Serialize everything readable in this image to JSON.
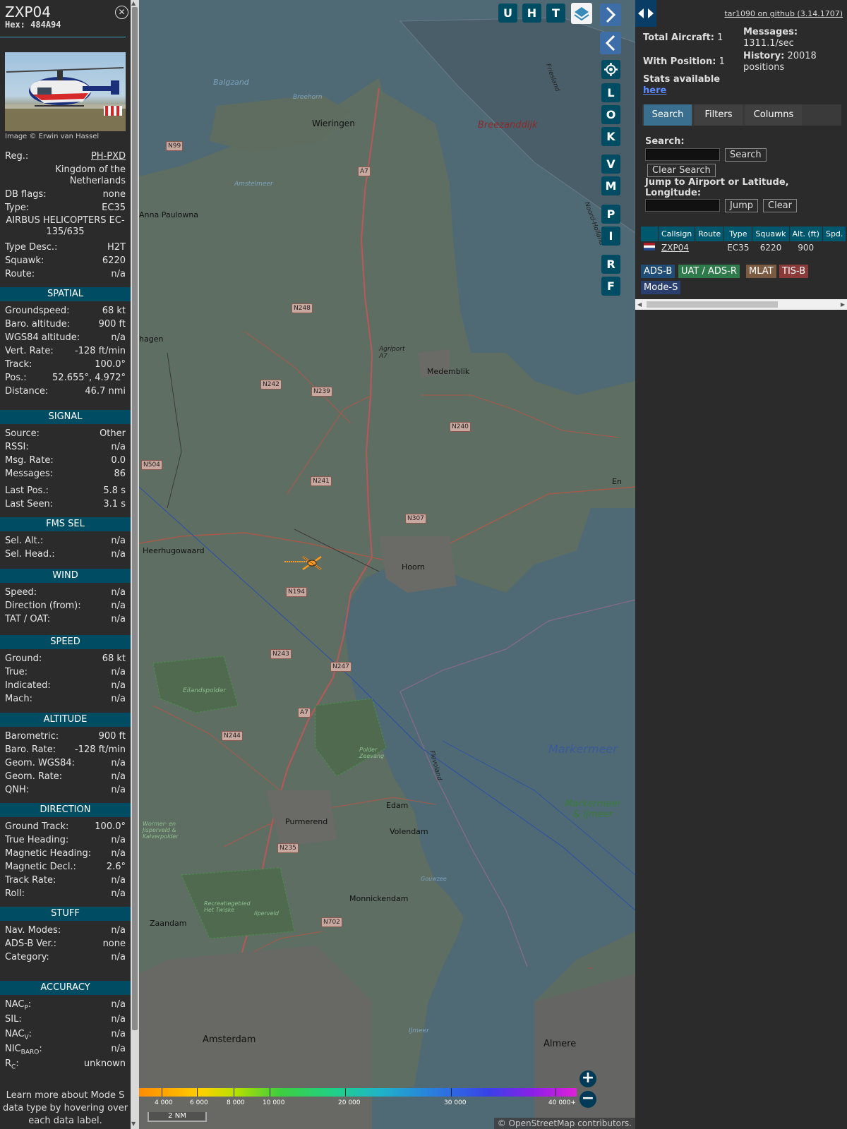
{
  "aircraft": {
    "callsign": "ZXP04",
    "hex_label": "Hex:",
    "hex": "484A94",
    "image_credit": "Image © Erwin van Hassel",
    "reg_label": "Reg.:",
    "reg": "PH-PXD",
    "country": "Kingdom of the Netherlands",
    "db_flags_label": "DB flags:",
    "db_flags": "none",
    "type_label": "Type:",
    "type": "EC35",
    "model": "AIRBUS HELICOPTERS EC-135/635",
    "type_desc_label": "Type Desc.:",
    "type_desc": "H2T",
    "squawk_label": "Squawk:",
    "squawk": "6220",
    "route_label": "Route:",
    "route": "n/a"
  },
  "sections": {
    "spatial": {
      "title": "SPATIAL",
      "rows": [
        {
          "k": "Groundspeed:",
          "v": "68 kt"
        },
        {
          "k": "Baro. altitude:",
          "v": "900 ft"
        },
        {
          "k": "WGS84 altitude:",
          "v": "n/a"
        },
        {
          "k": "Vert. Rate:",
          "v": "-128 ft/min"
        },
        {
          "k": "Track:",
          "v": "100.0°"
        },
        {
          "k": "Pos.:",
          "v": "52.655°, 4.972°"
        },
        {
          "k": "Distance:",
          "v": "46.7 nmi"
        }
      ]
    },
    "signal": {
      "title": "SIGNAL",
      "rows": [
        {
          "k": "Source:",
          "v": "Other"
        },
        {
          "k": "RSSI:",
          "v": "n/a"
        },
        {
          "k": "Msg. Rate:",
          "v": "0.0"
        },
        {
          "k": "Messages:",
          "v": "86"
        },
        {
          "k": "Last Pos.:",
          "v": "5.8 s"
        },
        {
          "k": "Last Seen:",
          "v": "3.1 s"
        }
      ]
    },
    "fms": {
      "title": "FMS SEL",
      "rows": [
        {
          "k": "Sel. Alt.:",
          "v": "n/a"
        },
        {
          "k": "Sel. Head.:",
          "v": "n/a"
        }
      ]
    },
    "wind": {
      "title": "WIND",
      "rows": [
        {
          "k": "Speed:",
          "v": "n/a"
        },
        {
          "k": "Direction (from):",
          "v": "n/a"
        },
        {
          "k": "TAT / OAT:",
          "v": "n/a"
        }
      ]
    },
    "speed": {
      "title": "SPEED",
      "rows": [
        {
          "k": "Ground:",
          "v": "68 kt"
        },
        {
          "k": "True:",
          "v": "n/a"
        },
        {
          "k": "Indicated:",
          "v": "n/a"
        },
        {
          "k": "Mach:",
          "v": "n/a"
        }
      ]
    },
    "altitude": {
      "title": "ALTITUDE",
      "rows": [
        {
          "k": "Barometric:",
          "v": "900 ft"
        },
        {
          "k": "Baro. Rate:",
          "v": "-128 ft/min"
        },
        {
          "k": "Geom. WGS84:",
          "v": "n/a"
        },
        {
          "k": "Geom. Rate:",
          "v": "n/a"
        },
        {
          "k": "QNH:",
          "v": "n/a"
        }
      ]
    },
    "direction": {
      "title": "DIRECTION",
      "rows": [
        {
          "k": "Ground Track:",
          "v": "100.0°"
        },
        {
          "k": "True Heading:",
          "v": "n/a"
        },
        {
          "k": "Magnetic Heading:",
          "v": "n/a"
        },
        {
          "k": "Magnetic Decl.:",
          "v": "2.6°"
        },
        {
          "k": "Track Rate:",
          "v": "n/a"
        },
        {
          "k": "Roll:",
          "v": "n/a"
        }
      ]
    },
    "stuff": {
      "title": "STUFF",
      "rows": [
        {
          "k": "Nav. Modes:",
          "v": "n/a"
        },
        {
          "k": "ADS-B Ver.:",
          "v": "none"
        },
        {
          "k": "Category:",
          "v": "n/a"
        }
      ]
    },
    "accuracy": {
      "title": "ACCURACY",
      "rows": [
        {
          "k": "NAC",
          "sub": "P",
          "v": "n/a"
        },
        {
          "k": "SIL:",
          "sub": "",
          "v": "n/a"
        },
        {
          "k": "NAC",
          "sub": "V",
          "v": "n/a"
        },
        {
          "k": "NIC",
          "sub": "BARO",
          "v": "n/a"
        },
        {
          "k": "R",
          "sub": "C",
          "v": "unknown"
        }
      ]
    }
  },
  "footer_text": "Learn more about Mode S data type by hovering over each data label.",
  "map": {
    "buttons": {
      "u": "U",
      "h": "H",
      "t": "T",
      "l": "L",
      "o": "O",
      "k": "K",
      "v": "V",
      "m": "M",
      "p": "P",
      "i": "I",
      "r": "R",
      "f": "F"
    },
    "places": [
      {
        "name": "Balgzand"
      },
      {
        "name": "Breehorn"
      },
      {
        "name": "Wieringen"
      },
      {
        "name": "Breezanddijk"
      },
      {
        "name": "Amstelmeer"
      },
      {
        "name": "Anna Paulowna"
      },
      {
        "name": "Medemblik"
      },
      {
        "name": "Agriport A7"
      },
      {
        "name": "Heerhugowaard"
      },
      {
        "name": "Hoorn"
      },
      {
        "name": "Eilandspolder"
      },
      {
        "name": "Markermeer"
      },
      {
        "name": "Markermeer & IJmeer"
      },
      {
        "name": "Edam"
      },
      {
        "name": "Volendam"
      },
      {
        "name": "Purmerend"
      },
      {
        "name": "Monnickendam"
      },
      {
        "name": "Zaandam"
      },
      {
        "name": "Amsterdam"
      },
      {
        "name": "Almere"
      },
      {
        "name": "Noord-Holland"
      },
      {
        "name": "Flevoland"
      },
      {
        "name": "Friesland"
      },
      {
        "name": "Wormer- en Jisperveld & Kalverpolder"
      },
      {
        "name": "Recreatiegebied Het Twiske"
      },
      {
        "name": "Ilperveld"
      },
      {
        "name": "Polder Zeevang"
      },
      {
        "name": "Gouwzee"
      },
      {
        "name": "IJmeer"
      },
      {
        "name": "En"
      },
      {
        "name": "hagen"
      }
    ],
    "roads": [
      "N99",
      "A7",
      "N248",
      "N242",
      "N239",
      "N240",
      "N504",
      "N241",
      "N307",
      "N194",
      "N243",
      "N247",
      "N244",
      "N235",
      "N702"
    ],
    "altitude_scale": [
      "4 000",
      "6 000",
      "8 000",
      "10 000",
      "20 000",
      "30 000",
      "40 000+"
    ],
    "distance_scale": "2 NM",
    "attribution": "© OpenStreetMap contributors."
  },
  "right": {
    "github": "tar1090 on github (3.14.1707)",
    "total_aircraft_label": "Total Aircraft:",
    "total_aircraft": "1",
    "with_position_label": "With Position:",
    "with_position": "1",
    "stats_label": "Stats available",
    "stats_link": "here",
    "messages_label": "Messages:",
    "messages": "1311.1/sec",
    "history_label": "History:",
    "history": "20018 positions",
    "tabs": [
      "Search",
      "Filters",
      "Columns"
    ],
    "search_label": "Search:",
    "search_btn": "Search",
    "clear_search_btn": "Clear Search",
    "jump_label": "Jump to Airport or Latitude, Longitude:",
    "jump_btn": "Jump",
    "clear_btn": "Clear",
    "columns": [
      "Callsign",
      "Route",
      "Type",
      "Squawk",
      "Alt. (ft)",
      "Spd."
    ],
    "row": {
      "callsign": "ZXP04",
      "route": "",
      "type": "EC35",
      "squawk": "6220",
      "alt": "900",
      "spd": ""
    },
    "sources": [
      "ADS-B",
      "UAT / ADS-R",
      "MLAT",
      "TIS-B",
      "Mode-S"
    ]
  },
  "colors": {
    "section_header": "#004d63",
    "panel_bg": "#2b2b2b",
    "track": "#ff9a1a",
    "adsb": "#1f4d76",
    "uat": "#2f7a4a",
    "mlat": "#7a5a40",
    "tisb": "#8a3a38",
    "modes": "#2a3f6e"
  }
}
